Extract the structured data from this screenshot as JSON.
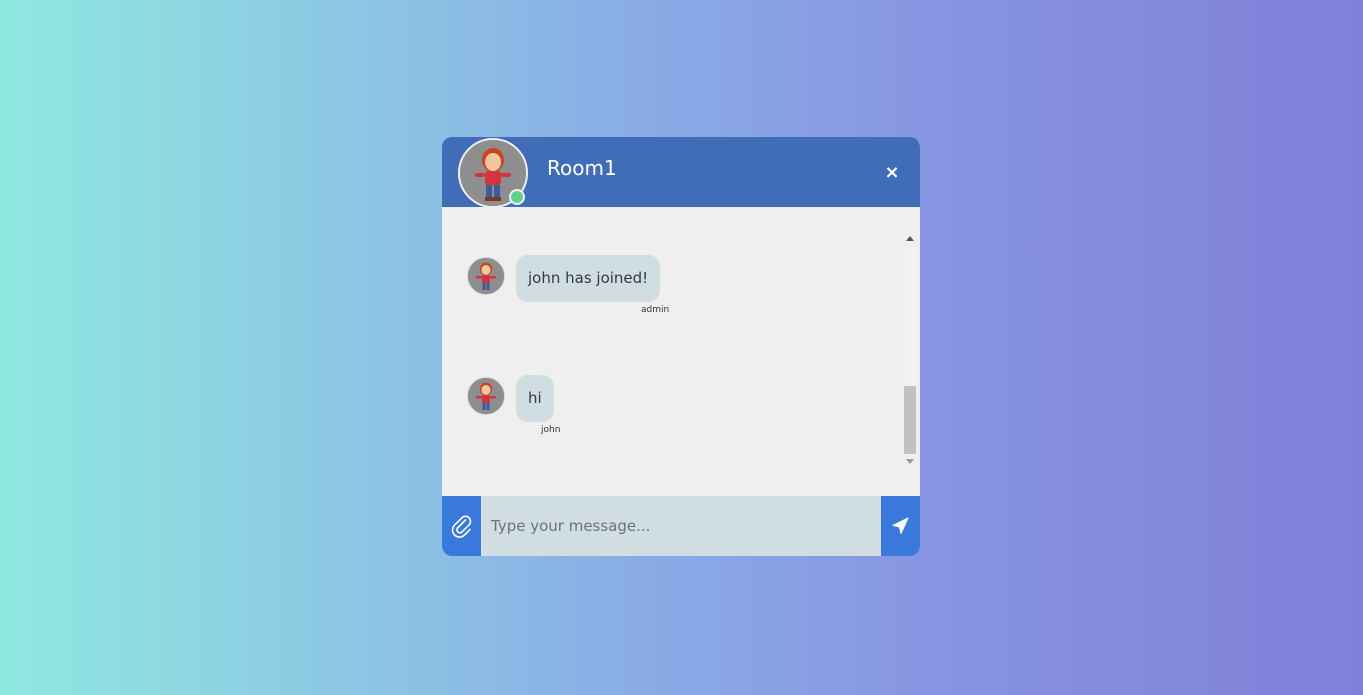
{
  "header": {
    "room_name": "Room1",
    "close_label": "×",
    "status": "online"
  },
  "messages": [
    {
      "text": "john has joined!",
      "sender": "admin"
    },
    {
      "text": "hi",
      "sender": "john"
    }
  ],
  "composer": {
    "placeholder": "Type your message...",
    "attach_icon": "paperclip-icon",
    "send_icon": "send-icon"
  },
  "colors": {
    "header": "#416db8",
    "online": "#5fd38b",
    "bubble": "#d0dde1",
    "input_bar": "#3a79dc"
  }
}
